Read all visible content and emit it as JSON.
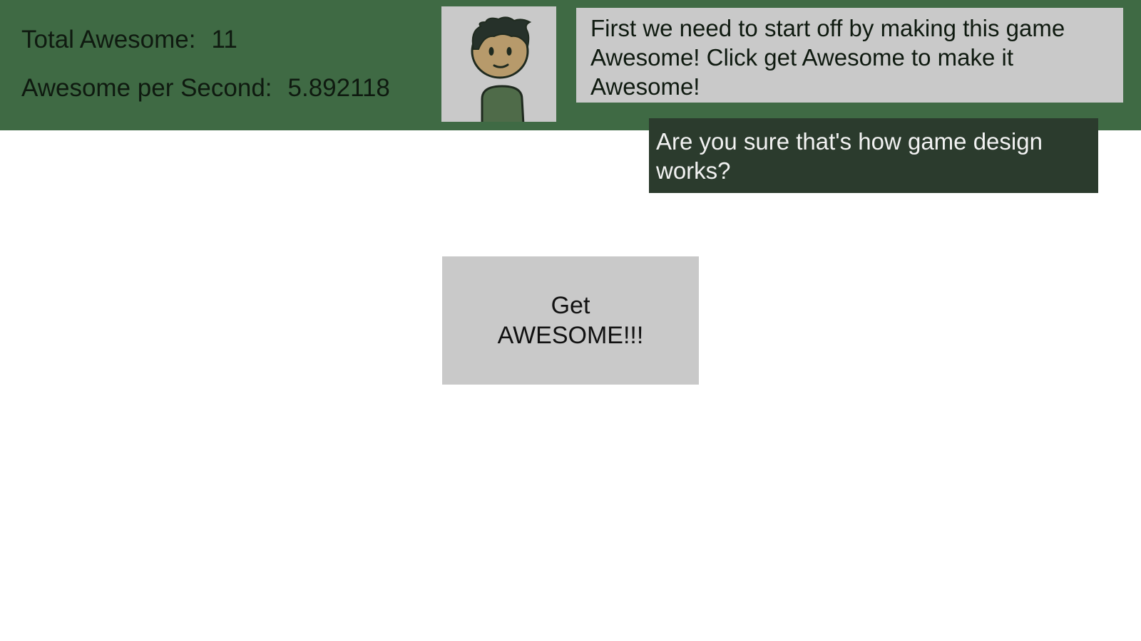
{
  "stats": {
    "total_label": "Total Awesome:",
    "total_value": "11",
    "rate_label": "Awesome per Second:",
    "rate_value": "5.892118"
  },
  "portrait": {
    "icon": "character-portrait-icon",
    "background_color": "#c9c9c9"
  },
  "dialog": {
    "main_text": "First we need to start off by making this game Awesome! Click get Awesome to make it Awesome!",
    "reply_text": "Are you sure that's how game design works?"
  },
  "button": {
    "label": "Get\nAWESOME!!!"
  },
  "colors": {
    "top_bar": "#3f6a44",
    "reply_bubble": "#2b3b2d",
    "panel_gray": "#c9c9c9",
    "page_background": "#ffffff"
  }
}
